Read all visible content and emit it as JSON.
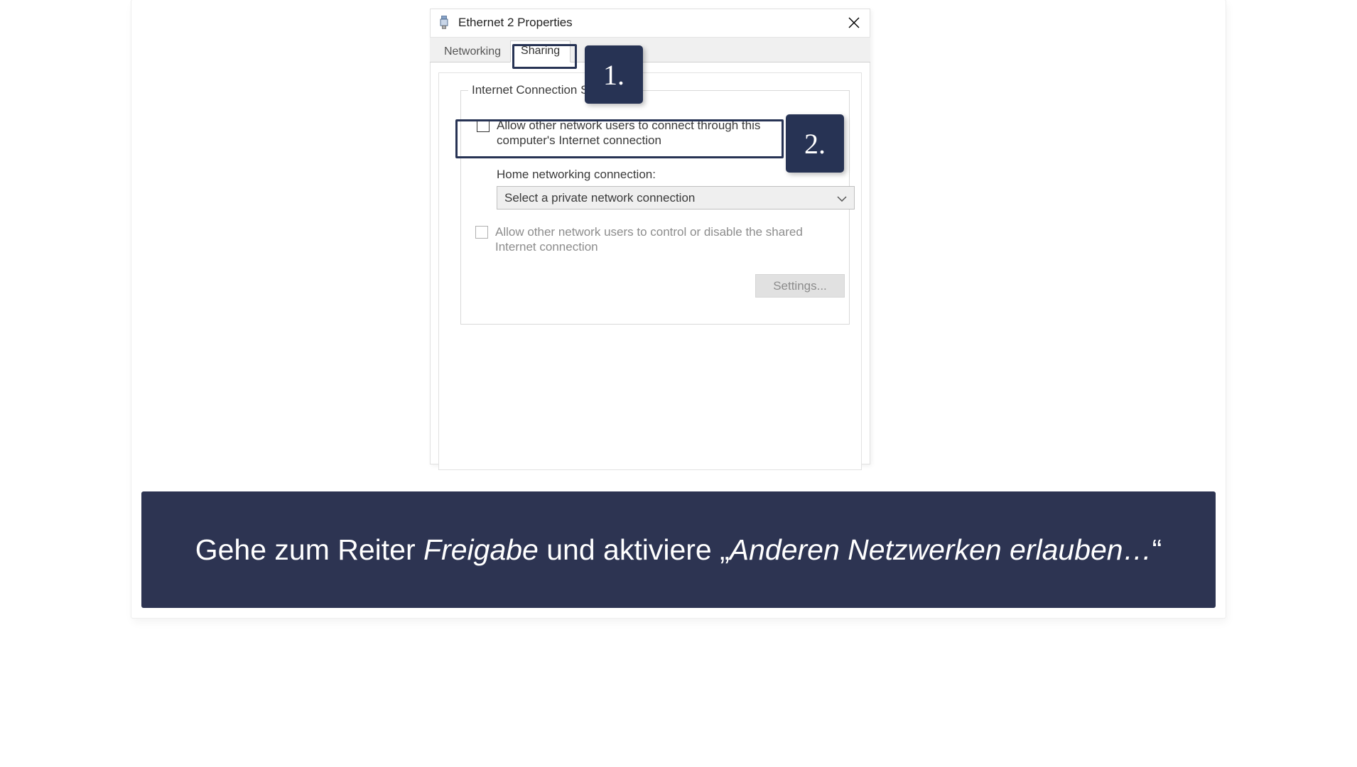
{
  "dialog": {
    "title": "Ethernet 2 Properties",
    "tabs": {
      "networking": "Networking",
      "sharing": "Sharing"
    },
    "group_label": "Internet Connection Sharing",
    "allow_connect_label": "Allow other network users to connect through this computer's Internet connection",
    "home_label": "Home networking connection:",
    "select_value": "Select a private network connection",
    "allow_control_label": "Allow other network users to control or disable the shared Internet connection",
    "settings_btn": "Settings..."
  },
  "markers": {
    "one": "1.",
    "two": "2."
  },
  "caption": {
    "pre": "Gehe zum Reiter ",
    "em1": "Freigabe",
    "mid": " und aktiviere „",
    "em2": "Anderen Netzwerken erlauben…",
    "post": "“"
  }
}
